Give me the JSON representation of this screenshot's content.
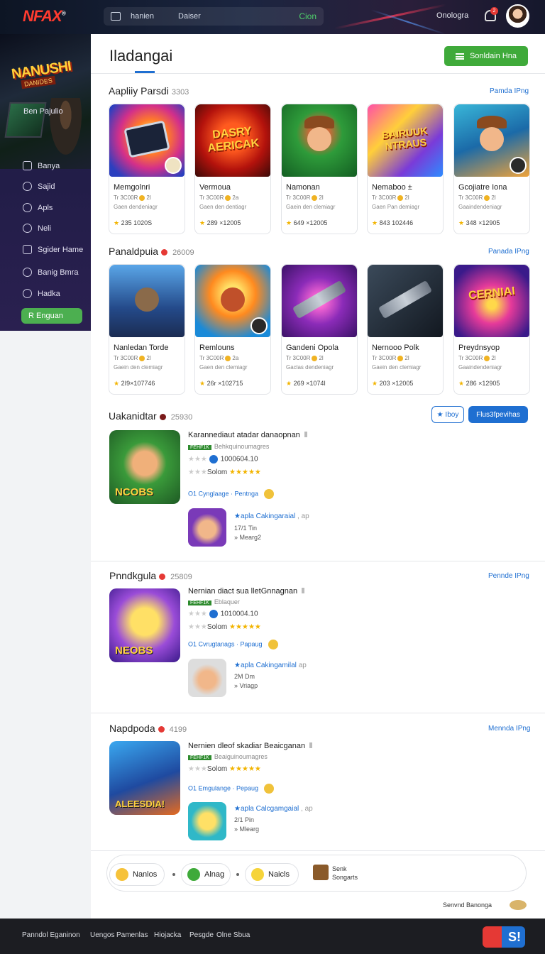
{
  "header": {
    "logo": "NFAX",
    "logo_mark": "®",
    "nav": [
      "hanien",
      "Daiser",
      "Cion"
    ],
    "user": "Onologra",
    "notifications": "2"
  },
  "sidebar": {
    "banner_title": "NANUSHI",
    "banner_sub": "DANIDES",
    "heading": "Ben Pajulio",
    "items": [
      {
        "label": "Banya",
        "icon": "grid-icon"
      },
      {
        "label": "Sajid",
        "icon": "globe-icon"
      },
      {
        "label": "Apls",
        "icon": "compass-icon"
      },
      {
        "label": "Neli",
        "icon": "tag-icon"
      },
      {
        "label": "Sgider Hame",
        "icon": "store-icon"
      },
      {
        "label": "Banig Bmra",
        "icon": "gamepad-icon"
      },
      {
        "label": "Hadka",
        "icon": "heart-icon"
      }
    ],
    "cta": "R Enguan"
  },
  "main": {
    "title": "Iladangai",
    "primary_button": "Sonldain Hna",
    "section1": {
      "title": "Aapliiy Parsdi",
      "count": "3303",
      "link": "Pamda IPng",
      "cards": [
        {
          "name": "Memgolnri",
          "meta": "Tr 3C00R",
          "meta2": "2l",
          "desc": "Gaen dendeniagr",
          "rating": "235 1020S"
        },
        {
          "name": "Vermoua",
          "meta": "Tr 3C00R",
          "meta2": "2a",
          "desc": "Gaen den dentiagr",
          "rating": "289 ×12005",
          "art_text": "DASRY AERICAK"
        },
        {
          "name": "Namonan",
          "meta": "Tr 3C00R",
          "meta2": "2l",
          "desc": "Gaein den clemiagr",
          "rating": "649 ×12005"
        },
        {
          "name": "Nemaboo ±",
          "meta": "Tr 3C00R",
          "meta2": "2l",
          "desc": "Gaen Pan demiagr",
          "rating": "843 102446",
          "art_text": "BAIRUUK NTRAUS"
        },
        {
          "name": "Gcojiatre Iona",
          "meta": "Tr 3C00R",
          "meta2": "2l",
          "desc": "Gaaindendeniagr",
          "rating": "348 ×12905"
        }
      ]
    },
    "section2": {
      "title": "Panaldpuia",
      "count": "26009",
      "link": "Panada IPng",
      "cards": [
        {
          "name": "Nanledan Torde",
          "meta": "Tr 3C00R",
          "meta2": "2l",
          "desc": "Gaein den clemiagr",
          "rating": "2I9×107746"
        },
        {
          "name": "Remlouns",
          "meta": "Tr 3C00R",
          "meta2": "2a",
          "desc": "Gaen den clemiagr",
          "rating": "26r ×102715"
        },
        {
          "name": "Gandeni Opola",
          "meta": "Tr 3C00R",
          "meta2": "2l",
          "desc": "Gaclas dendeniagr",
          "rating": "269 ×1074I"
        },
        {
          "name": "Nernooo Polk",
          "meta": "Tr 3C00R",
          "meta2": "2l",
          "desc": "Gaein den clemiagr",
          "rating": "203 ×12005"
        },
        {
          "name": "Preydnsyop",
          "meta": "Tr 3C00R",
          "meta2": "2l",
          "desc": "Gaaindendeniagr",
          "rating": "286 ×12905",
          "art_text": "CERNIAI"
        }
      ]
    },
    "section3": {
      "title": "Uakanidtar",
      "count": "25930",
      "btn_outline": "★ Iboy",
      "btn_solid": "Flus3fpevihas",
      "entry": {
        "icon_text": "NCOBS",
        "title": "Karannediaut atadar danaopnan",
        "tag": "FEHF1K",
        "sub": "Behkquinoumagres",
        "ver": "1000604.10",
        "rating_label": "Solom",
        "links": "O1 Cynglaage · Pentnga",
        "mini_title": "★apla Cakingaraial",
        "mini_suffix": ", ap",
        "mini_line1": "17/1 Tin",
        "mini_line2": "» Mearg2"
      }
    },
    "section4": {
      "title": "Pnndkgula",
      "count": "25809",
      "link": "Pennde IPng",
      "entry": {
        "icon_text": "NEOBS",
        "title": "Nernian diact sua lletGnnagnan",
        "tag": "FEHF1K",
        "sub": "Eblaquer",
        "ver": "1010004.10",
        "rating_label": "Solom",
        "links": "O1 Cvrugtanags · Papaug",
        "mini_title": "★apla Cakingamilal",
        "mini_suffix": "ap",
        "mini_line1": "2M Dm",
        "mini_line2": "» Vriagp"
      }
    },
    "section5": {
      "title": "Napdpoda",
      "count": "4199",
      "link": "Mennda IPng",
      "entry": {
        "icon_text": "ALEESDIA!",
        "title": "Nernien dleof skadiar Beaicganan",
        "tag": "FEHF1K",
        "sub": "Beaiguinoumagres",
        "rating_label": "Solom",
        "links": "O1 Emgulange · Pepaug",
        "mini_title": "★apla Calcgamgaial",
        "mini_suffix": ", ap",
        "mini_line1": "2/1 Pin",
        "mini_line2": "» Mlearg"
      }
    },
    "pills": [
      "Nanlos",
      "Alnag",
      "Naicls"
    ],
    "pills_extra": [
      "Senk",
      "Songarts"
    ],
    "footnote": "Senvnd Banonga"
  },
  "footer": {
    "links": [
      "Panndol Eganinon",
      "Uengos",
      "Pamenlas",
      "Hiojacka",
      "Pesgde",
      "Olne Sbua"
    ],
    "logo": "S!"
  }
}
